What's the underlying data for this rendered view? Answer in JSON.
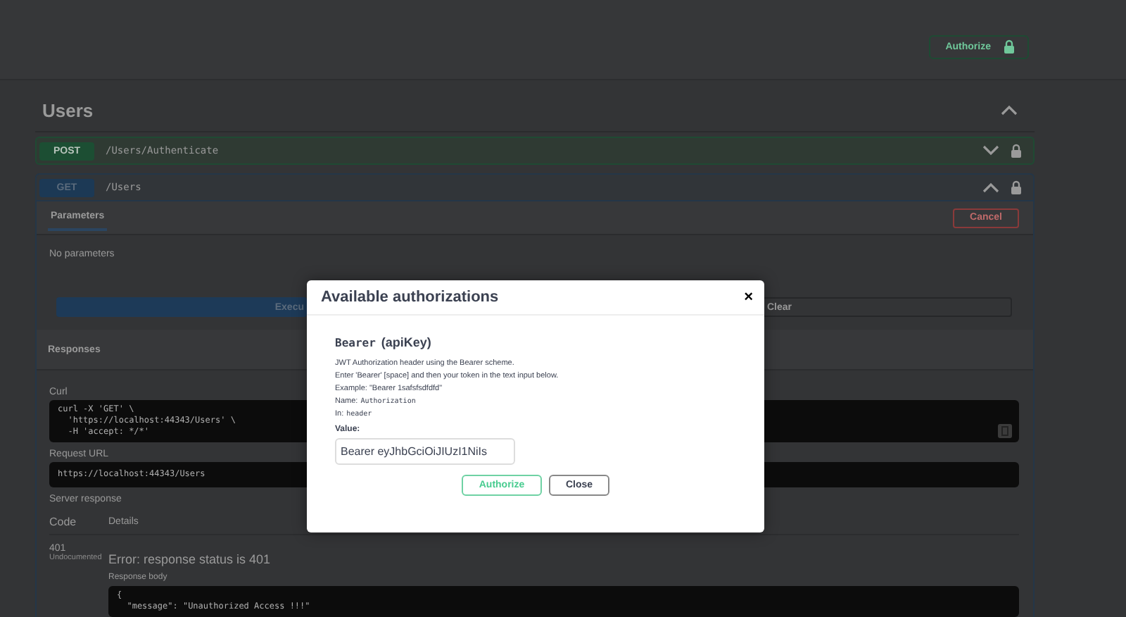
{
  "top_bar": {
    "authorize_button": "Authorize"
  },
  "section": {
    "title": "Users",
    "expanded": true
  },
  "operations": [
    {
      "method": "POST",
      "path": "/Users/Authenticate",
      "expanded": false
    },
    {
      "method": "GET",
      "path": "/Users",
      "expanded": true
    }
  ],
  "get_panel": {
    "parameters_tab": "Parameters",
    "cancel_button": "Cancel",
    "no_parameters": "No parameters",
    "execute_button": "Execu",
    "clear_button": "Clear",
    "responses_title": "Responses",
    "curl_label": "Curl",
    "curl_lines": [
      "curl -X 'GET' \\",
      "  'https://localhost:44343/Users' \\",
      "  -H 'accept: */*'"
    ],
    "request_url_label": "Request URL",
    "request_url": "https://localhost:44343/Users",
    "server_response_label": "Server response",
    "columns": [
      "Code",
      "Details"
    ],
    "response": {
      "code": "401",
      "note": "Undocumented",
      "error": "Error: response status is 401",
      "body_label": "Response body",
      "body_lines": [
        "{",
        "  \"message\": \"Unauthorized Access !!!\""
      ]
    }
  },
  "dialog": {
    "title": "Available authorizations",
    "close": "×",
    "scheme_name": "Bearer",
    "scheme_type": "(apiKey)",
    "description": [
      "JWT Authorization header using the Bearer scheme.",
      "Enter 'Bearer' [space] and then your token in the text input below.",
      "Example: \"Bearer 1safsfsdfdfd\""
    ],
    "name_label": "Name:",
    "name_value": "Authorization",
    "in_label": "In:",
    "in_value": "header",
    "value_label": "Value:",
    "value": "Bearer eyJhbGciOiJIUzI1NiIs",
    "authorize_button": "Authorize",
    "close_button": "Close"
  }
}
